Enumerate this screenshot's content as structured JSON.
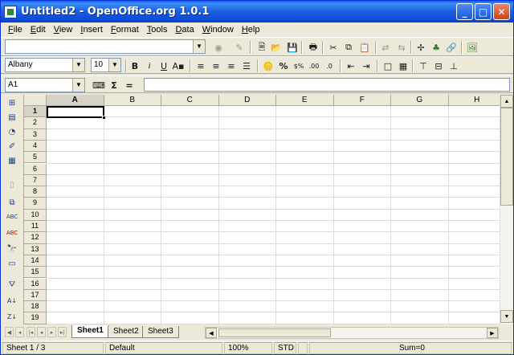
{
  "window": {
    "title": "Untitled2 - OpenOffice.org 1.0.1"
  },
  "menu": [
    "File",
    "Edit",
    "View",
    "Insert",
    "Format",
    "Tools",
    "Data",
    "Window",
    "Help"
  ],
  "toolbar": {
    "url_value": ""
  },
  "format": {
    "font_name": "Albany",
    "font_size": "10",
    "bold": "B",
    "italic": "i",
    "underline": "U",
    "percent": "%"
  },
  "formula": {
    "name_box": "A1",
    "sum": "Σ",
    "equals": "="
  },
  "columns": [
    "A",
    "B",
    "C",
    "D",
    "E",
    "F",
    "G",
    "H"
  ],
  "rows": [
    "1",
    "2",
    "3",
    "4",
    "5",
    "6",
    "7",
    "8",
    "9",
    "10",
    "11",
    "12",
    "13",
    "14",
    "15",
    "16",
    "17",
    "18",
    "19"
  ],
  "sheets": [
    "Sheet1",
    "Sheet2",
    "Sheet3"
  ],
  "status": {
    "sheet_pos": "Sheet 1 / 3",
    "page_style": "Default",
    "zoom": "100%",
    "mode": "STD",
    "sum": "Sum=0"
  }
}
